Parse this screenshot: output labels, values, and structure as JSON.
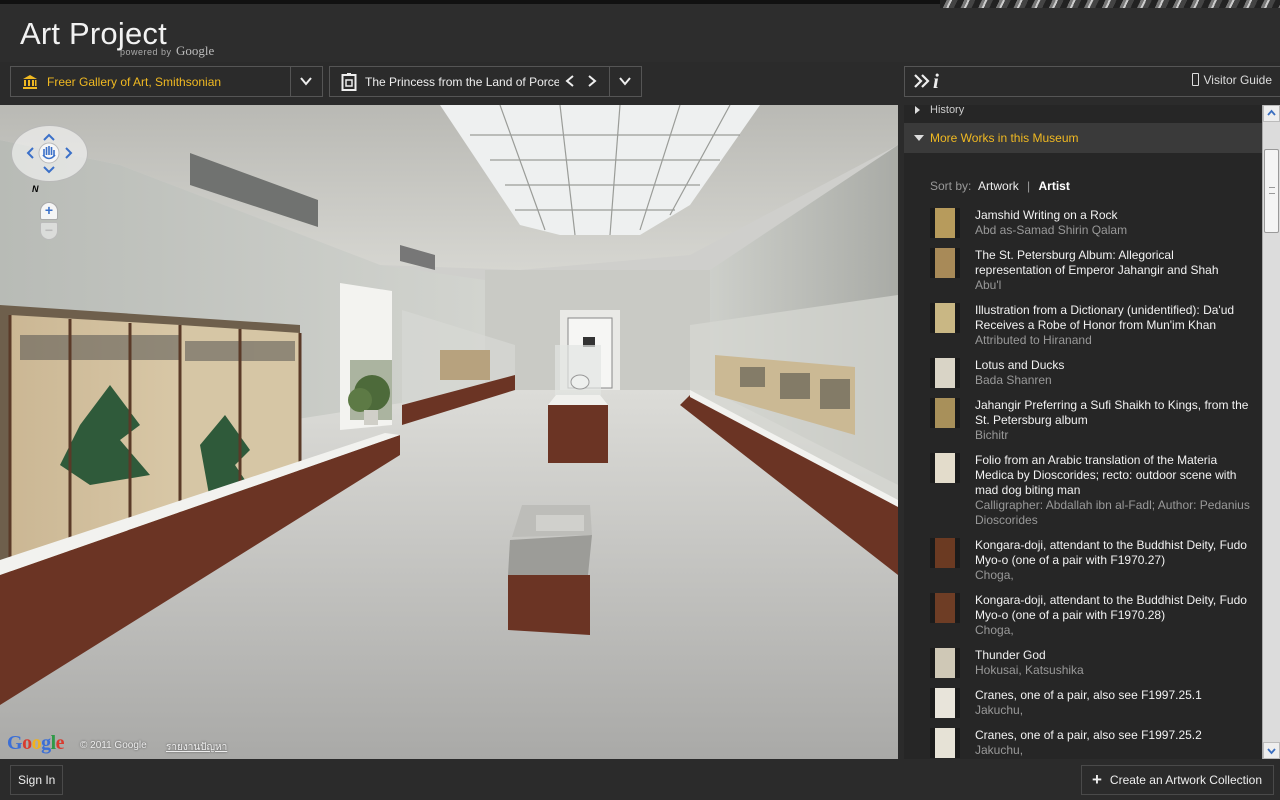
{
  "app": {
    "title": "Art Project",
    "powered_by": "powered by",
    "google": "Google"
  },
  "toolbar": {
    "museum": {
      "name": "Freer Gallery of Art, Smithsonian",
      "icon": "museum-icon"
    },
    "artwork": {
      "title": "The Princess from the Land of Porcelain",
      "icon": "artwork-frame-icon"
    },
    "info_icon": "i",
    "visitor_guide_label": "Visitor Guide"
  },
  "viewer": {
    "north_label": "N",
    "google_logo": "Google",
    "copyright": "© 2011 Google",
    "report_link": "รายงานปัญหา"
  },
  "panel": {
    "history_label": "History",
    "more_works_label": "More Works in this Museum",
    "sort": {
      "label": "Sort by:",
      "artwork": "Artwork",
      "separator": "|",
      "artist": "Artist",
      "active": "Artist"
    },
    "works": [
      {
        "title": "Jamshid Writing on a Rock",
        "artist": "Abd as-Samad Shirin Qalam",
        "thumb": "#b79b5c"
      },
      {
        "title": "The St. Petersburg Album: Allegorical representation of Emperor Jahangir and Shah",
        "artist": "Abu'l",
        "thumb": "#a88a58"
      },
      {
        "title": "Illustration from a Dictionary (unidentified): Da'ud Receives a Robe of Honor from Mun'im Khan",
        "artist": "Attributed to Hiranand",
        "thumb": "#c9b784"
      },
      {
        "title": "Lotus and Ducks",
        "artist": "Bada Shanren",
        "thumb": "#d9d4c6"
      },
      {
        "title": "Jahangir Preferring a Sufi Shaikh to Kings, from the St. Petersburg album",
        "artist": "Bichitr",
        "thumb": "#a8905a"
      },
      {
        "title": "Folio from an Arabic translation of the Materia Medica by Dioscorides; recto: outdoor scene with mad dog biting man",
        "artist": "Calligrapher: Abdallah ibn al-Fadl; Author: Pedanius Dioscorides",
        "thumb": "#e3dccb"
      },
      {
        "title": "Kongara-doji, attendant to the Buddhist Deity, Fudo Myo-o (one of a pair with F1970.27)",
        "artist": "Choga,",
        "thumb": "#6b3a22"
      },
      {
        "title": "Kongara-doji, attendant to the Buddhist Deity, Fudo Myo-o (one of a pair with F1970.28)",
        "artist": "Choga,",
        "thumb": "#6e3d25"
      },
      {
        "title": "Thunder God",
        "artist": "Hokusai, Katsushika",
        "thumb": "#cfc8b6"
      },
      {
        "title": "Cranes, one of a pair, also see F1997.25.1",
        "artist": "Jakuchu,",
        "thumb": "#e8e4da"
      },
      {
        "title": "Cranes, one of a pair, also see F1997.25.2",
        "artist": "Jakuchu,",
        "thumb": "#e6e2d6"
      }
    ]
  },
  "footer": {
    "sign_in_label": "Sign In",
    "create_collection_label": "Create an Artwork Collection"
  },
  "colors": {
    "accent": "#f0b922",
    "background": "#2b2b2b",
    "panel": "#262626"
  }
}
